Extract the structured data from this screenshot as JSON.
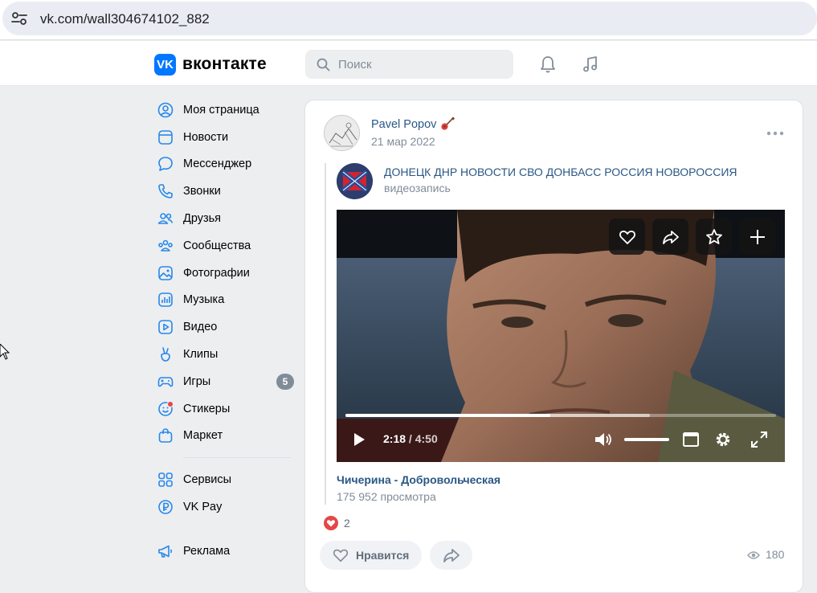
{
  "browser": {
    "url": "vk.com/wall304674102_882"
  },
  "header": {
    "logo": "VK",
    "wordmark": "вконтакте",
    "search_placeholder": "Поиск"
  },
  "nav": {
    "items": [
      {
        "label": "Моя страница",
        "icon": "user-circle-icon"
      },
      {
        "label": "Новости",
        "icon": "news-icon"
      },
      {
        "label": "Мессенджер",
        "icon": "message-icon"
      },
      {
        "label": "Звонки",
        "icon": "phone-icon"
      },
      {
        "label": "Друзья",
        "icon": "friends-icon"
      },
      {
        "label": "Сообщества",
        "icon": "communities-icon"
      },
      {
        "label": "Фотографии",
        "icon": "photo-icon"
      },
      {
        "label": "Музыка",
        "icon": "music-icon"
      },
      {
        "label": "Видео",
        "icon": "video-icon"
      },
      {
        "label": "Клипы",
        "icon": "clips-icon"
      },
      {
        "label": "Игры",
        "icon": "games-icon",
        "badge": "5"
      },
      {
        "label": "Стикеры",
        "icon": "stickers-icon"
      },
      {
        "label": "Маркет",
        "icon": "market-icon"
      }
    ],
    "secondary": [
      {
        "label": "Сервисы",
        "icon": "services-icon"
      },
      {
        "label": "VK Pay",
        "icon": "vkpay-icon"
      }
    ],
    "tertiary": [
      {
        "label": "Реклама",
        "icon": "ads-icon"
      }
    ]
  },
  "post": {
    "author": "Pavel Popov",
    "date": "21 мар 2022",
    "repost": {
      "group_name": "ДОНЕЦК ДНР НОВОСТИ СВО ДОНБАСС РОССИЯ НОВОРОССИЯ",
      "subtitle": "видеозапись"
    },
    "video": {
      "time_current": "2:18",
      "time_separator": "/",
      "time_total": "4:50",
      "progress": 0.476,
      "buffered": 0.708,
      "volume": 1.0,
      "title": "Чичерина - Добровольческая",
      "views": "175 952 просмотра"
    },
    "reactions_count": "2",
    "like_label": "Нравится",
    "views_count": "180"
  },
  "colors": {
    "accent": "#0077ff",
    "link": "#2a5885",
    "muted": "#818c99",
    "bg": "#edeef0"
  }
}
